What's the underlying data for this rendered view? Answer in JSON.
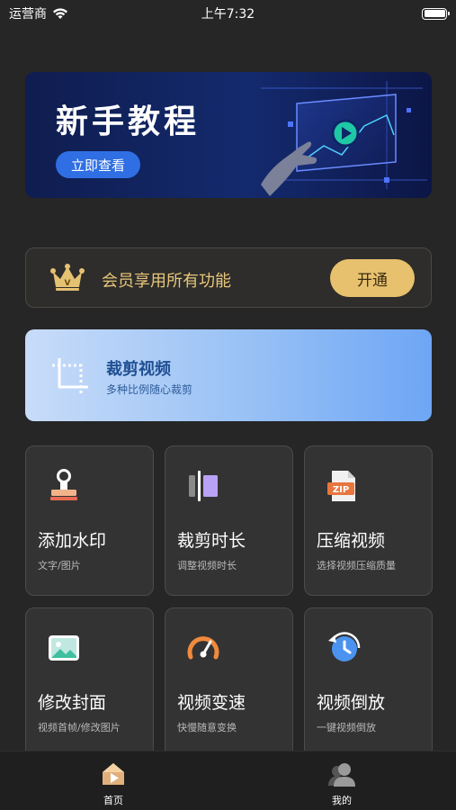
{
  "status_bar": {
    "carrier": "运营商",
    "time": "上午7:32"
  },
  "banner": {
    "title": "新手教程",
    "button": "立即查看"
  },
  "vip": {
    "label": "会员享用所有功能",
    "button": "开通"
  },
  "crop_video": {
    "title": "裁剪视频",
    "subtitle": "多种比例随心裁剪"
  },
  "tools": [
    {
      "title": "添加水印",
      "subtitle": "文字/图片",
      "icon": "stamp-icon"
    },
    {
      "title": "裁剪时长",
      "subtitle": "调整视频时长",
      "icon": "trim-duration-icon"
    },
    {
      "title": "压缩视频",
      "subtitle": "选择视频压缩质量",
      "icon": "zip-file-icon"
    },
    {
      "title": "修改封面",
      "subtitle": "视频首帧/修改图片",
      "icon": "image-icon"
    },
    {
      "title": "视频变速",
      "subtitle": "快慢随意变换",
      "icon": "speedometer-icon"
    },
    {
      "title": "视频倒放",
      "subtitle": "一键视频倒放",
      "icon": "reverse-clock-icon"
    }
  ],
  "tabbar": [
    {
      "label": "首页",
      "icon": "home-icon",
      "active": true
    },
    {
      "label": "我的",
      "icon": "profile-icon",
      "active": false
    }
  ]
}
